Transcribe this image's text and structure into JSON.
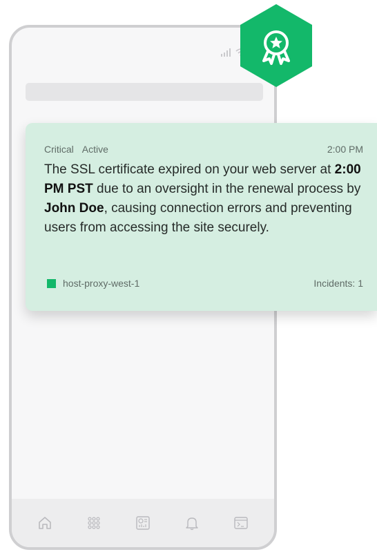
{
  "alert": {
    "severity": "Critical",
    "state": "Active",
    "time": "2:00 PM",
    "message_part1": "The SSL certificate expired on your web server at ",
    "message_bold1": "2:00 PM PST",
    "message_part2": " due to an oversight in the renewal process by ",
    "message_bold2": "John Doe",
    "message_part3": ", causing connection errors and preventing users from accessing the site securely.",
    "host": "host-proxy-west-1",
    "incidents": "Incidents: 1"
  },
  "colors": {
    "accent": "#13b86a",
    "card_bg": "#d5eee1"
  },
  "icons": {
    "badge": "award-ribbon-icon",
    "nav": [
      "home-icon",
      "apps-grid-icon",
      "dashboard-icon",
      "bell-icon",
      "terminal-icon"
    ]
  }
}
